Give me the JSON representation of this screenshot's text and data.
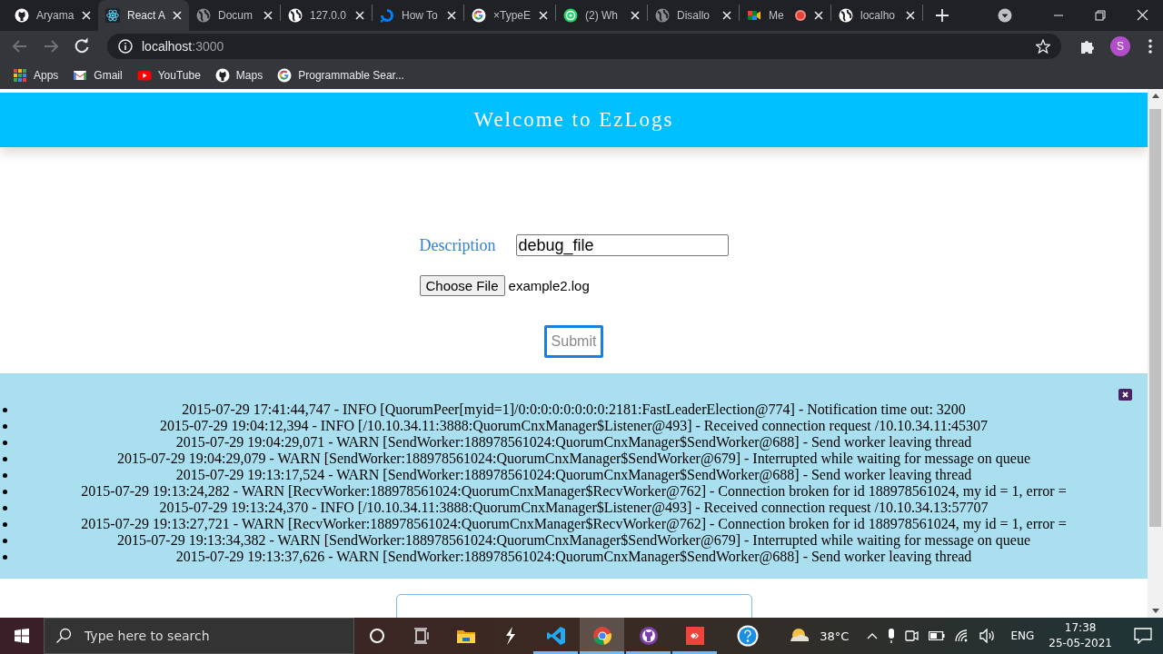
{
  "browser": {
    "tabs": [
      {
        "title": "Aryama",
        "kind": "github",
        "selected": false,
        "recording": false
      },
      {
        "title": "React A",
        "kind": "react",
        "selected": true,
        "recording": false
      },
      {
        "title": "Docum",
        "kind": "globe-grey",
        "selected": false,
        "recording": false
      },
      {
        "title": "127.0.0",
        "kind": "globe",
        "selected": false,
        "recording": false
      },
      {
        "title": "How To",
        "kind": "swirl",
        "selected": false,
        "recording": false
      },
      {
        "title": "×TypeE",
        "kind": "google",
        "selected": false,
        "recording": false
      },
      {
        "title": "(2) Wh",
        "kind": "whatsapp",
        "selected": false,
        "recording": false
      },
      {
        "title": "Disallo",
        "kind": "globe-grey",
        "selected": false,
        "recording": false
      },
      {
        "title": "Me",
        "kind": "meet",
        "selected": false,
        "recording": true
      },
      {
        "title": "localho",
        "kind": "globe",
        "selected": false,
        "recording": false
      }
    ],
    "address": {
      "host": "localhost",
      "port": ":3000"
    },
    "profile": "S",
    "bookmarks": [
      {
        "label": "Apps",
        "kind": "apps"
      },
      {
        "label": "Gmail",
        "kind": "gmail"
      },
      {
        "label": "YouTube",
        "kind": "youtube"
      },
      {
        "label": "Maps",
        "kind": "github"
      },
      {
        "label": "Programmable Sear...",
        "kind": "google"
      }
    ]
  },
  "page": {
    "title": "Welcome to EzLogs",
    "form": {
      "description_label": "Description",
      "description_value": "debug_file",
      "file_button": "Choose File",
      "file_name": "example2.log",
      "submit_button": "Submit"
    },
    "logs": [
      "2015-07-29 17:41:44,747 - INFO [QuorumPeer[myid=1]/0:0:0:0:0:0:0:0:2181:FastLeaderElection@774] - Notification time out: 3200",
      "2015-07-29 19:04:12,394 - INFO [/10.10.34.11:3888:QuorumCnxManager$Listener@493] - Received connection request /10.10.34.11:45307",
      "2015-07-29 19:04:29,071 - WARN [SendWorker:188978561024:QuorumCnxManager$SendWorker@688] - Send worker leaving thread",
      "2015-07-29 19:04:29,079 - WARN [SendWorker:188978561024:QuorumCnxManager$SendWorker@679] - Interrupted while waiting for message on queue",
      "2015-07-29 19:13:17,524 - WARN [SendWorker:188978561024:QuorumCnxManager$SendWorker@688] - Send worker leaving thread",
      "2015-07-29 19:13:24,282 - WARN [RecvWorker:188978561024:QuorumCnxManager$RecvWorker@762] - Connection broken for id 188978561024, my id = 1, error =",
      "2015-07-29 19:13:24,370 - INFO [/10.10.34.11:3888:QuorumCnxManager$Listener@493] - Received connection request /10.10.34.13:57707",
      "2015-07-29 19:13:27,721 - WARN [RecvWorker:188978561024:QuorumCnxManager$RecvWorker@762] - Connection broken for id 188978561024, my id = 1, error =",
      "2015-07-29 19:13:34,382 - WARN [SendWorker:188978561024:QuorumCnxManager$SendWorker@679] - Interrupted while waiting for message on queue",
      "2015-07-29 19:13:37,626 - WARN [SendWorker:188978561024:QuorumCnxManager$SendWorker@688] - Send worker leaving thread"
    ]
  },
  "taskbar": {
    "search_placeholder": "Type here to search",
    "apps": [
      {
        "kind": "cortana",
        "running": false,
        "selected": false
      },
      {
        "kind": "taskview",
        "running": false,
        "selected": false
      },
      {
        "kind": "folder",
        "running": false,
        "selected": false
      },
      {
        "kind": "bolt",
        "running": false,
        "selected": false
      },
      {
        "kind": "vscode",
        "running": true,
        "selected": false
      },
      {
        "kind": "chrome",
        "running": true,
        "selected": true
      },
      {
        "kind": "github",
        "running": true,
        "selected": false
      },
      {
        "kind": "anydesk",
        "running": true,
        "selected": false
      }
    ],
    "weather": "38°C",
    "language": "ENG",
    "time": "17:38",
    "date": "25-05-2021"
  }
}
